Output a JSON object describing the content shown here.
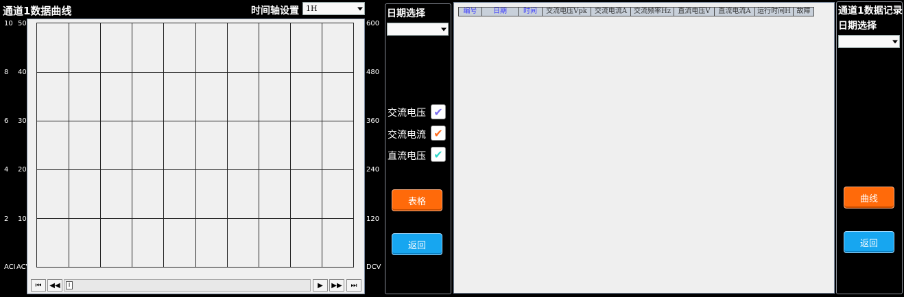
{
  "left": {
    "title": "通道1数据曲线",
    "timeaxis_label": "时间轴设置",
    "timeaxis_value": "1H",
    "y_left_outer": [
      "10",
      "8",
      "6",
      "4",
      "2"
    ],
    "y_left_inner": [
      "50",
      "40",
      "30",
      "20",
      "10"
    ],
    "y_right": [
      "600",
      "480",
      "360",
      "240",
      "120"
    ],
    "axis_bottom_left_1": "ACI",
    "axis_bottom_left_2": "ACV",
    "axis_bottom_right": "DCV",
    "nav": {
      "first": "⏮",
      "prev": "◀◀",
      "mark": "I",
      "next": "▶",
      "fastfwd": "▶▶",
      "last": "⏭"
    }
  },
  "middle": {
    "date_label": "日期选择",
    "date_value": "",
    "checks": [
      {
        "label": "交流电压",
        "mark": "✔",
        "color": "#7a6cf0"
      },
      {
        "label": "交流电流",
        "mark": "✔",
        "color": "#ff6a1a"
      },
      {
        "label": "直流电压",
        "mark": "✔",
        "color": "#2fd6c8"
      }
    ],
    "table_button": "表格",
    "back_button": "返回"
  },
  "table": {
    "headers": [
      "编号",
      "日期",
      "时间",
      "交流电压Vpk",
      "交流电流A",
      "交流频率Hz",
      "直流电压V",
      "直流电流A",
      "运行时间H",
      "故障"
    ]
  },
  "right": {
    "title": "通道1数据记录",
    "date_label": "日期选择",
    "date_value": "",
    "curve_button": "曲线",
    "back_button": "返回"
  },
  "colors": {
    "orange": "#ff6a0a",
    "blue": "#17a6f0",
    "background": "#000000"
  }
}
